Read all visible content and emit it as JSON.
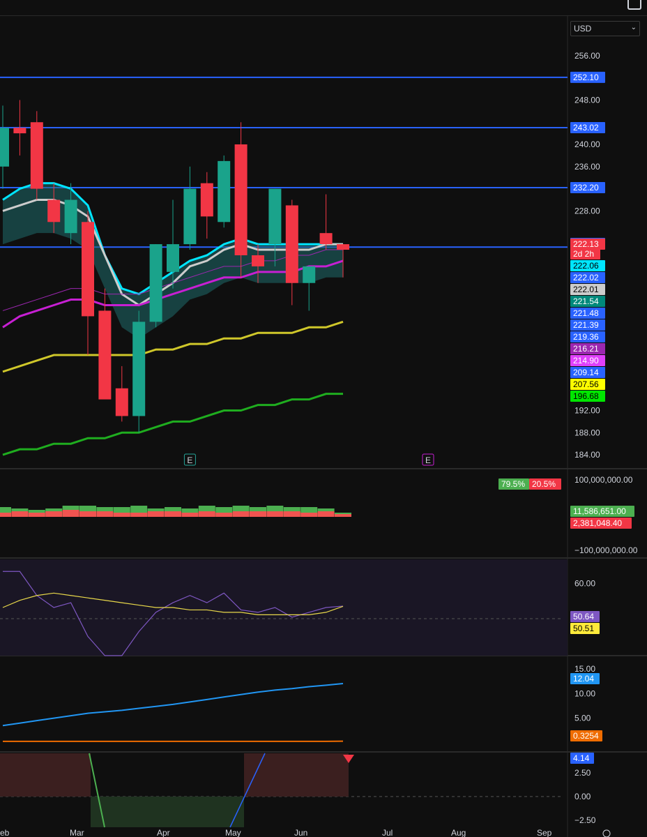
{
  "currency": {
    "label": "USD"
  },
  "colors": {
    "background": "#0f0f0f",
    "up": "#1aa38b",
    "down": "#f23645",
    "hline": "#2962ff",
    "ema_teal": "#00e5ff",
    "ema_white": "#cccccc",
    "ma_purple": "#c71fd3",
    "ma_purple_thin": "#9c27b0",
    "ma_yellow": "#cfc72a",
    "ma_green": "#1fad1f",
    "vol_up": "#4caf50",
    "vol_down": "#f05350",
    "rsi": "#7e57c2",
    "rsi_ma": "#e8d84a",
    "line_blue": "#2196f3",
    "line_orange": "#ef6c00"
  },
  "chart_data": [
    {
      "type": "candlestick",
      "name": "price",
      "ylim": [
        182,
        259
      ],
      "y_ticks": [
        "256.00",
        "248.00",
        "240.00",
        "236.00",
        "232.00",
        "228.00",
        "192.00",
        "188.00",
        "184.00"
      ],
      "x_labels": [
        "eb",
        "Mar",
        "Apr",
        "May",
        "Jun",
        "Jul",
        "Aug",
        "Sep"
      ],
      "candles": [
        {
          "o": 236,
          "h": 247,
          "l": 232,
          "c": 243
        },
        {
          "o": 243,
          "h": 248,
          "l": 238,
          "c": 242
        },
        {
          "o": 244,
          "h": 246,
          "l": 230,
          "c": 232
        },
        {
          "o": 230,
          "h": 233,
          "l": 224,
          "c": 226
        },
        {
          "o": 224,
          "h": 233,
          "l": 222,
          "c": 230
        },
        {
          "o": 226,
          "h": 228,
          "l": 202,
          "c": 209
        },
        {
          "o": 210,
          "h": 214,
          "l": 195,
          "c": 194
        },
        {
          "o": 196,
          "h": 200,
          "l": 190,
          "c": 191
        },
        {
          "o": 191,
          "h": 210,
          "l": 188,
          "c": 208
        },
        {
          "o": 208,
          "h": 222,
          "l": 207,
          "c": 222
        },
        {
          "o": 217,
          "h": 230,
          "l": 214,
          "c": 222
        },
        {
          "o": 222,
          "h": 236,
          "l": 221,
          "c": 232
        },
        {
          "o": 233,
          "h": 235,
          "l": 223,
          "c": 227
        },
        {
          "o": 226,
          "h": 238,
          "l": 225,
          "c": 237
        },
        {
          "o": 240,
          "h": 244,
          "l": 216,
          "c": 220
        },
        {
          "o": 220,
          "h": 222,
          "l": 215,
          "c": 218
        },
        {
          "o": 222,
          "h": 232,
          "l": 218,
          "c": 232
        },
        {
          "o": 229,
          "h": 230,
          "l": 211,
          "c": 215
        },
        {
          "o": 215,
          "h": 218,
          "l": 210,
          "c": 218
        },
        {
          "o": 224,
          "h": 231,
          "l": 221,
          "c": 222
        },
        {
          "o": 222,
          "h": 222,
          "l": 216,
          "c": 221
        }
      ],
      "horizontal_lines": [
        252.1,
        243.02,
        232.2,
        221.48
      ],
      "x_event_markers": [
        {
          "label": "E",
          "color": "#26a69a",
          "x_index": 11
        },
        {
          "label": "E",
          "color": "#c71fd3",
          "x_index": 25
        }
      ],
      "price_tags": [
        {
          "label": "252.10",
          "bg": "#2962ff",
          "fg": "#ffffff",
          "v": 252.1
        },
        {
          "label": "243.02",
          "bg": "#2962ff",
          "fg": "#ffffff",
          "v": 243.02
        },
        {
          "label": "232.20",
          "bg": "#2962ff",
          "fg": "#ffffff",
          "v": 232.2
        },
        {
          "label": "222.13",
          "bg": "#2962ff",
          "fg": "#ffffff",
          "v": 222.13
        },
        {
          "label": "222.13",
          "bg": "#f23645",
          "fg": "#ffffff",
          "v": 222.13,
          "row": 1
        },
        {
          "label": "2d 2h",
          "bg": "#f23645",
          "fg": "#ffffff",
          "row": 2
        },
        {
          "label": "222.06",
          "bg": "#00e5ff",
          "fg": "#000000",
          "row": 3
        },
        {
          "label": "222.02",
          "bg": "#2962ff",
          "fg": "#ffffff",
          "row": 4
        },
        {
          "label": "222.01",
          "bg": "#cccccc",
          "fg": "#000000",
          "row": 5
        },
        {
          "label": "221.54",
          "bg": "#00897b",
          "fg": "#ffffff",
          "row": 6
        },
        {
          "label": "221.48",
          "bg": "#2962ff",
          "fg": "#ffffff",
          "row": 7
        },
        {
          "label": "221.39",
          "bg": "#2962ff",
          "fg": "#ffffff",
          "row": 8
        },
        {
          "label": "219.36",
          "bg": "#2962ff",
          "fg": "#ffffff",
          "row": 9
        },
        {
          "label": "216.21",
          "bg": "#9c27b0",
          "fg": "#ffffff",
          "row": 10
        },
        {
          "label": "214.90",
          "bg": "#e040fb",
          "fg": "#ffffff",
          "row": 11
        },
        {
          "label": "209.14",
          "bg": "#2962ff",
          "fg": "#ffffff",
          "row": 12
        },
        {
          "label": "207.56",
          "bg": "#ffff00",
          "fg": "#000000",
          "row": 13
        },
        {
          "label": "196.68",
          "bg": "#00e600",
          "fg": "#000000",
          "row": 14
        }
      ],
      "ma_lines": [
        {
          "name": "teal",
          "color": "#00e5ff",
          "values": [
            230,
            232,
            233,
            233,
            232,
            229,
            220,
            214,
            213,
            215,
            217,
            219,
            220,
            222,
            223,
            222,
            222,
            222,
            222,
            222,
            222
          ]
        },
        {
          "name": "white",
          "color": "#cccccc",
          "values": [
            228,
            229,
            230,
            230,
            229,
            227,
            220,
            213,
            211,
            213,
            215,
            218,
            219,
            221,
            222,
            221,
            221,
            221,
            221,
            222,
            222
          ]
        },
        {
          "name": "purple",
          "color": "#c71fd3",
          "values": [
            207,
            209,
            210,
            211,
            212,
            212,
            211,
            211,
            211,
            212,
            213,
            214,
            215,
            216,
            216,
            217,
            217,
            217,
            218,
            218,
            219
          ]
        },
        {
          "name": "purple_thin",
          "color": "#9c27b0",
          "values": [
            210,
            211,
            212,
            213,
            214,
            214,
            213,
            213,
            213,
            214,
            215,
            216,
            217,
            218,
            218,
            219,
            219,
            220,
            220,
            221,
            221
          ]
        },
        {
          "name": "yellow",
          "color": "#cfc72a",
          "values": [
            199,
            200,
            201,
            202,
            202,
            202,
            202,
            202,
            202,
            203,
            203,
            204,
            204,
            205,
            205,
            206,
            206,
            206,
            207,
            207,
            208
          ]
        },
        {
          "name": "green",
          "color": "#1fad1f",
          "values": [
            184,
            185,
            185,
            186,
            186,
            187,
            187,
            188,
            188,
            189,
            190,
            190,
            191,
            192,
            192,
            193,
            193,
            194,
            194,
            195,
            195
          ]
        }
      ]
    },
    {
      "type": "bar",
      "name": "volume",
      "y_ticks": [
        "100,000,000.00",
        "−100,000,000.00"
      ],
      "buy_pct_label": "79.5%",
      "sell_pct_label": "20.5%",
      "tags": [
        {
          "label": "11,586,651.00",
          "bg": "#4caf50",
          "fg": "#ffffff"
        },
        {
          "label": "2,381,048.40",
          "bg": "#f23645",
          "fg": "#ffffff"
        }
      ],
      "up_values": [
        14,
        12,
        10,
        12,
        16,
        16,
        14,
        14,
        16,
        12,
        14,
        12,
        16,
        14,
        16,
        14,
        16,
        14,
        14,
        12,
        6
      ],
      "down_values": [
        6,
        8,
        6,
        8,
        10,
        8,
        8,
        6,
        6,
        8,
        8,
        6,
        8,
        6,
        8,
        8,
        8,
        8,
        6,
        8,
        4
      ]
    },
    {
      "type": "line",
      "name": "rsi",
      "ylim": [
        30,
        70
      ],
      "y_ticks": [
        "60.00"
      ],
      "tags": [
        {
          "label": "50.64",
          "bg": "#7e57c2",
          "fg": "#ffffff"
        },
        {
          "label": "50.51",
          "bg": "#ffeb3b",
          "fg": "#000000"
        }
      ],
      "series": [
        {
          "color": "#7e57c2",
          "values": [
            65,
            65,
            55,
            50,
            52,
            38,
            30,
            30,
            40,
            48,
            52,
            55,
            52,
            56,
            49,
            48,
            50,
            46,
            48,
            50,
            50.6
          ]
        },
        {
          "color": "#e8d84a",
          "values": [
            50,
            53,
            55,
            56,
            55,
            54,
            53,
            52,
            51,
            50,
            50,
            49,
            49,
            48,
            48,
            47,
            47,
            47,
            47,
            48,
            50.5
          ]
        }
      ]
    },
    {
      "type": "line",
      "name": "lower_lines",
      "ylim": [
        -1,
        16
      ],
      "y_ticks": [
        "15.00",
        "10.00",
        "5.00"
      ],
      "tags": [
        {
          "label": "12.04",
          "bg": "#2196f3",
          "fg": "#ffffff"
        },
        {
          "label": "0.3254",
          "bg": "#ef6c00",
          "fg": "#ffffff"
        }
      ],
      "series": [
        {
          "color": "#2196f3",
          "values": [
            3.5,
            4,
            4.5,
            5,
            5.5,
            6,
            6.3,
            6.6,
            7,
            7.4,
            7.8,
            8.3,
            8.8,
            9.3,
            9.8,
            10.3,
            10.7,
            11,
            11.4,
            11.7,
            12.04
          ]
        },
        {
          "color": "#ef6c00",
          "values": [
            0.3,
            0.3,
            0.3,
            0.3,
            0.3,
            0.3,
            0.3,
            0.3,
            0.3,
            0.3,
            0.3,
            0.3,
            0.3,
            0.3,
            0.3,
            0.3,
            0.3,
            0.3,
            0.3,
            0.3,
            0.3254
          ]
        }
      ]
    },
    {
      "type": "area",
      "name": "oscillator",
      "ylim": [
        -3,
        4.5
      ],
      "y_ticks": [
        "2.50",
        "0.00",
        "−2.50"
      ],
      "tags": [
        {
          "label": "4.14",
          "bg": "#2962ff",
          "fg": "#ffffff"
        }
      ],
      "values": [
        10,
        10,
        10,
        10,
        10,
        4.5,
        -3,
        -4,
        -6,
        -6,
        -5,
        -4,
        -3,
        -1,
        1,
        4,
        8,
        9,
        10,
        10,
        4.14
      ]
    }
  ]
}
